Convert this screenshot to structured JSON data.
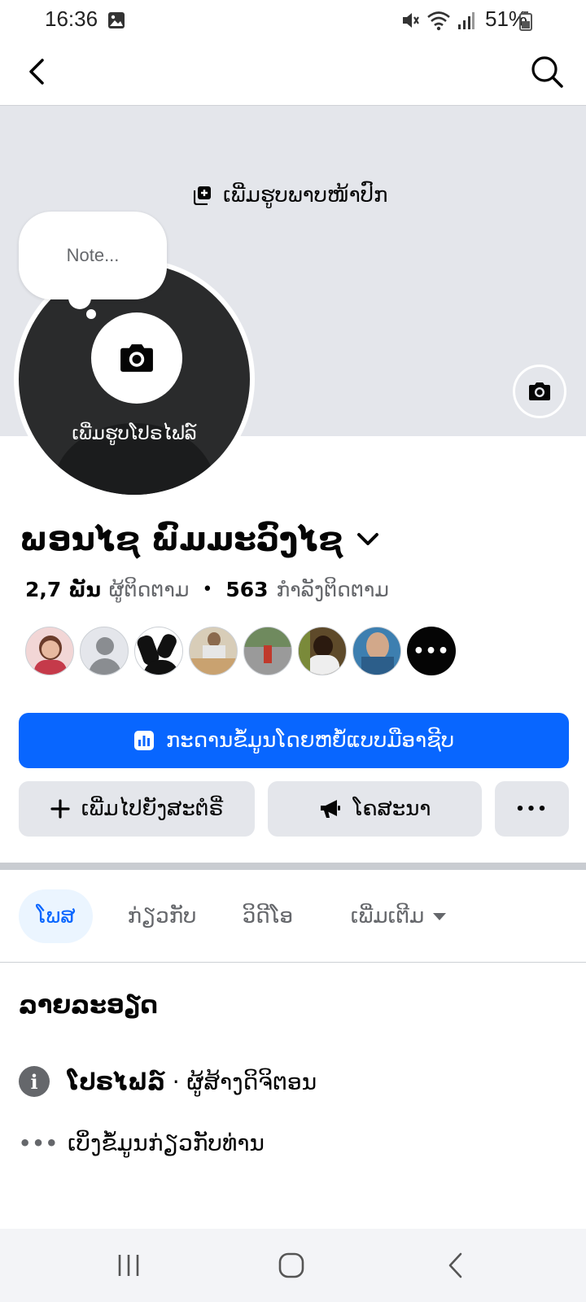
{
  "status_bar": {
    "time": "16:36",
    "battery": "51%",
    "icons": [
      "image-icon",
      "mute-icon",
      "wifi-icon",
      "signal-icon",
      "battery-icon"
    ]
  },
  "nav": {
    "back_icon": "back-arrow-icon",
    "search_icon": "search-icon"
  },
  "cover": {
    "add_cover_label": "ເພີ່ມຮູບພາບໜ້າປົກ"
  },
  "profile_photo": {
    "add_label": "ເພີ່ມຮູບໂປຣໄຟລ໌"
  },
  "note": {
    "placeholder": "Note..."
  },
  "profile": {
    "name": "ພອນໄຊ ພົມມະວົງໄຊ",
    "followers_count": "2,7 ພັນ",
    "followers_label": "ຜູ້ຕິດຕາມ",
    "following_count": "563",
    "following_label": "ກຳລັງຕິດຕາມ",
    "separator": "•"
  },
  "friends": {
    "avatar_colors": [
      "#d98a8a",
      "#bfc3c7",
      "#2a2a2a",
      "#c9b79a",
      "#8f8f8f",
      "#5e4a2a",
      "#3d7fb0"
    ],
    "more_label": "•••"
  },
  "actions": {
    "dashboard_label": "ກະດານຂໍ້ມູນໂດຍຫຍໍ້ແບບມືອາຊີບ",
    "add_story_label": "ເພີ່ມໄປຍັງສະຕໍຣີ່",
    "promote_label": "ໂຄສະນາ",
    "more_label": "•••"
  },
  "tabs": {
    "posts": "ໂພສ",
    "about": "ກ່ຽວກັບ",
    "videos": "ວິດີໂອ",
    "more": "ເພີ່ມເຕີມ"
  },
  "details": {
    "title": "ລາຍລະອຽດ",
    "profile_bold": "ໂປຣໄຟລ໌",
    "profile_rest": " · ຜູ້ສ້າງດິຈິຕອນ",
    "about_link": "ເບິ່ງຂໍ້ມູນກ່ຽວກັບທ່ານ"
  },
  "colors": {
    "accent": "#0866ff",
    "secondary_button": "#e4e6eb",
    "cover_bg": "#e4e6eb"
  }
}
